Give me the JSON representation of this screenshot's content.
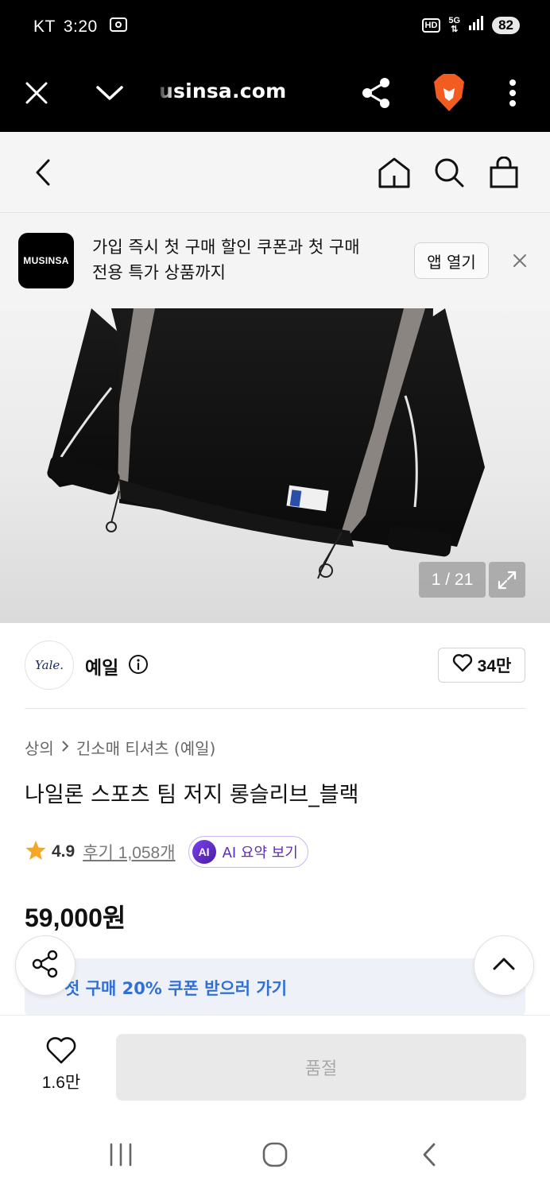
{
  "status_bar": {
    "carrier": "KT",
    "time": "3:20",
    "hd": "HD",
    "network": "5G",
    "battery": "82"
  },
  "browser": {
    "url": "usinsa.com",
    "icons": [
      "close-icon",
      "chevron-down-icon",
      "share-icon",
      "brave-lion-icon",
      "more-vert-icon"
    ]
  },
  "header": {
    "icons": [
      "back-icon",
      "home-icon",
      "search-icon",
      "shopping-bag-icon"
    ]
  },
  "promo": {
    "logo_text": "MUSINSA",
    "line1": "가입 즉시 첫 구매 할인 쿠폰과 첫 구매",
    "line2": "전용 특가 상품까지",
    "open_app": "앱 열기"
  },
  "gallery": {
    "counter": "1 / 21"
  },
  "brand": {
    "logo_text": "Yale.",
    "name": "예일",
    "likes": "34만"
  },
  "breadcrumb": {
    "category": "상의",
    "subcategory": "긴소매 티셔츠 (예일)"
  },
  "product": {
    "title": "나일론 스포츠 팀 저지 롱슬리브_블랙",
    "rating": "4.9",
    "reviews": "후기 1,058개",
    "ai_badge": "AI",
    "ai_summary": "AI 요약 보기",
    "price": "59,000원"
  },
  "coupon": {
    "text": "첫 구매 20% 쿠폰 받으러 가기"
  },
  "bottom": {
    "wish_count": "1.6만",
    "soldout": "품절"
  },
  "colors": {
    "accent_blue": "#2f6fd6",
    "ai_purple": "#5b2fb5",
    "star": "#f5a623",
    "brave_orange": "#f25c21"
  }
}
